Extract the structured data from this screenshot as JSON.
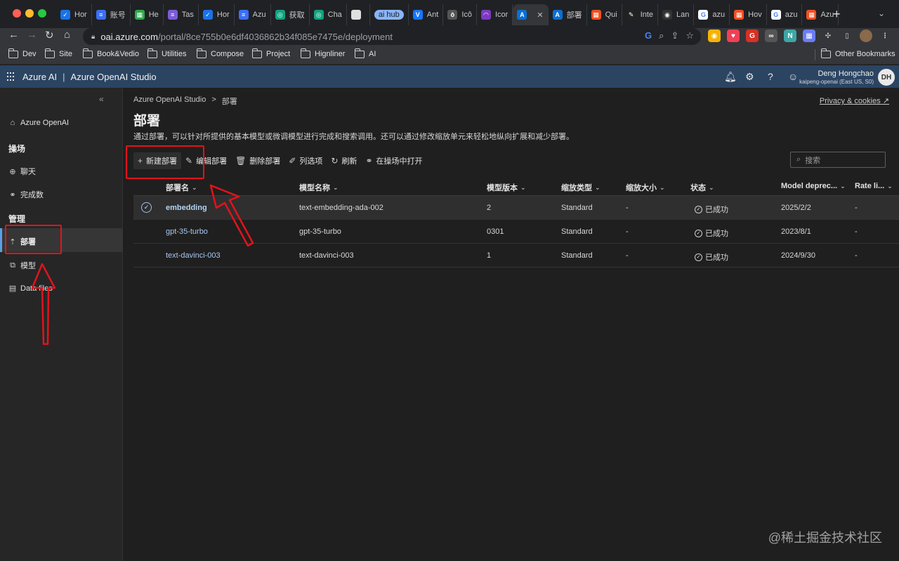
{
  "browser": {
    "tabs": [
      {
        "label": "Hor",
        "color": "#1a73e8",
        "glyph": "✓"
      },
      {
        "label": "账号",
        "color": "#3b6ff5",
        "glyph": "≡"
      },
      {
        "label": "He",
        "color": "#2fa84f",
        "glyph": "▦"
      },
      {
        "label": "Tas",
        "color": "#7b5cd6",
        "glyph": "≡"
      },
      {
        "label": "Hor",
        "color": "#1a73e8",
        "glyph": "✓"
      },
      {
        "label": "Azu",
        "color": "#3b6ff5",
        "glyph": "≡"
      },
      {
        "label": "获取",
        "color": "#10a37f",
        "glyph": "◎"
      },
      {
        "label": "Cha",
        "color": "#10a37f",
        "glyph": "◎"
      },
      {
        "label": "",
        "color": "#e0e0e0",
        "glyph": ""
      },
      {
        "label": "ai hub",
        "pill": true
      },
      {
        "label": "Ant",
        "color": "#1677ff",
        "glyph": "V"
      },
      {
        "label": "Icô",
        "color": "#555555",
        "glyph": "ô"
      },
      {
        "label": "Icor",
        "color": "#7d3ac1",
        "glyph": "◠"
      },
      {
        "label": "",
        "color": "#0a6fd6",
        "glyph": "A",
        "active": true
      },
      {
        "label": "部署",
        "color": "#0a6fd6",
        "glyph": "A"
      },
      {
        "label": "Qui",
        "color": "#f25022",
        "glyph": "▦"
      },
      {
        "label": "Inte",
        "color": "#222222",
        "glyph": "✎"
      },
      {
        "label": "Lan",
        "color": "#333333",
        "glyph": "◉"
      },
      {
        "label": "azu",
        "color": "#ffffff",
        "glyph": "G"
      },
      {
        "label": "Hov",
        "color": "#f25022",
        "glyph": "▦"
      },
      {
        "label": "azu",
        "color": "#ffffff",
        "glyph": "G"
      },
      {
        "label": "Azu",
        "color": "#f25022",
        "glyph": "▦"
      }
    ],
    "new_tab": "+",
    "url_host": "oai.azure.com",
    "url_path": "/portal/8ce755b0e6df4036862b34f085e7475e/deployment",
    "bookmarks": [
      "Dev",
      "Site",
      "Book&Vedio",
      "Utilities",
      "Compose",
      "Project",
      "Hignliner",
      "AI"
    ],
    "other_bookmarks": "Other Bookmarks"
  },
  "header": {
    "brand": "Azure AI",
    "separator": "|",
    "product": "Azure OpenAI Studio",
    "user_name": "Deng Hongchao",
    "user_sub": "kaipeng-openai (East US, S0)",
    "avatar": "DH"
  },
  "sidebar": {
    "collapse": "«",
    "azure_openai": "Azure OpenAI",
    "playground_head": "操场",
    "chat": "聊天",
    "completions": "完成数",
    "manage_head": "管理",
    "deployments": "部署",
    "models": "模型",
    "data_files": "Data files"
  },
  "main": {
    "breadcrumb_root": "Azure OpenAI Studio",
    "breadcrumb_sep": ">",
    "breadcrumb_current": "部署",
    "privacy": "Privacy & cookies",
    "title": "部署",
    "description": "通过部署，可以针对所提供的基本模型或微调模型进行完成和搜索调用。还可以通过修改缩放单元来轻松地纵向扩展和减少部署。",
    "commands": {
      "new": "新建部署",
      "edit": "编辑部署",
      "delete": "删除部署",
      "columns": "列选项",
      "refresh": "刷新",
      "open_playground": "在操场中打开"
    },
    "search_placeholder": "搜索",
    "columns": [
      "部署名",
      "模型名称",
      "模型版本",
      "缩放类型",
      "缩放大小",
      "状态",
      "Model deprec...",
      "Rate li..."
    ],
    "rows": [
      {
        "name": "embedding",
        "model": "text-embedding-ada-002",
        "version": "2",
        "scale_type": "Standard",
        "scale_size": "-",
        "status": "已成功",
        "deprecation": "2025/2/2",
        "rate": "-",
        "selected": true
      },
      {
        "name": "gpt-35-turbo",
        "model": "gpt-35-turbo",
        "version": "0301",
        "scale_type": "Standard",
        "scale_size": "-",
        "status": "已成功",
        "deprecation": "2023/8/1",
        "rate": "-"
      },
      {
        "name": "text-davinci-003",
        "model": "text-davinci-003",
        "version": "1",
        "scale_type": "Standard",
        "scale_size": "-",
        "status": "已成功",
        "deprecation": "2024/9/30",
        "rate": "-"
      }
    ]
  },
  "watermark": "@稀土掘金技术社区",
  "colors": {
    "annotation_red": "#e3131b",
    "header_blue": "#2b4462",
    "link_blue": "#a8c7f0"
  }
}
